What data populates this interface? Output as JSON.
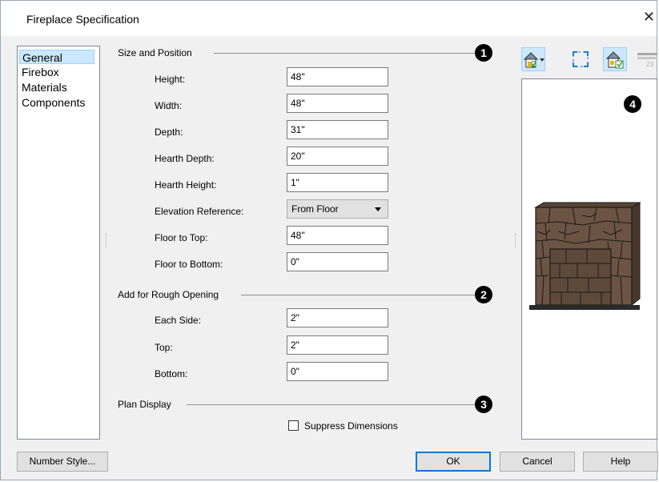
{
  "window": {
    "title": "Fireplace Specification",
    "close_glyph": "✕"
  },
  "nav": {
    "items": [
      {
        "label": "General",
        "selected": true
      },
      {
        "label": "Firebox"
      },
      {
        "label": "Materials"
      },
      {
        "label": "Components"
      }
    ]
  },
  "size_position": {
    "title": "Size and Position",
    "badge": "1",
    "fields": [
      {
        "label": "Height:",
        "value": "48\""
      },
      {
        "label": "Width:",
        "value": "48\""
      },
      {
        "label": "Depth:",
        "value": "31\""
      },
      {
        "label": "Hearth Depth:",
        "value": "20\""
      },
      {
        "label": "Hearth Height:",
        "value": "1\""
      }
    ],
    "elevation_label": "Elevation Reference:",
    "elevation_value": "From Floor",
    "floor_top_label": "Floor to Top:",
    "floor_top_value": "48\"",
    "floor_bottom_label": "Floor to Bottom:",
    "floor_bottom_value": "0\""
  },
  "rough_opening": {
    "title": "Add for Rough Opening",
    "badge": "2",
    "fields": [
      {
        "label": "Each Side:",
        "value": "2\""
      },
      {
        "label": "Top:",
        "value": "2\""
      },
      {
        "label": "Bottom:",
        "value": "0\""
      }
    ]
  },
  "plan_display": {
    "title": "Plan Display",
    "badge": "3",
    "suppress_label": "Suppress Dimensions",
    "suppress_checked": false
  },
  "preview": {
    "badge": "4"
  },
  "footer": {
    "number_style": "Number Style...",
    "ok": "OK",
    "cancel": "Cancel",
    "help": "Help"
  },
  "colors": {
    "accent": "#0078d7",
    "selection": "#cce8ff",
    "stone": "#6b5443"
  }
}
